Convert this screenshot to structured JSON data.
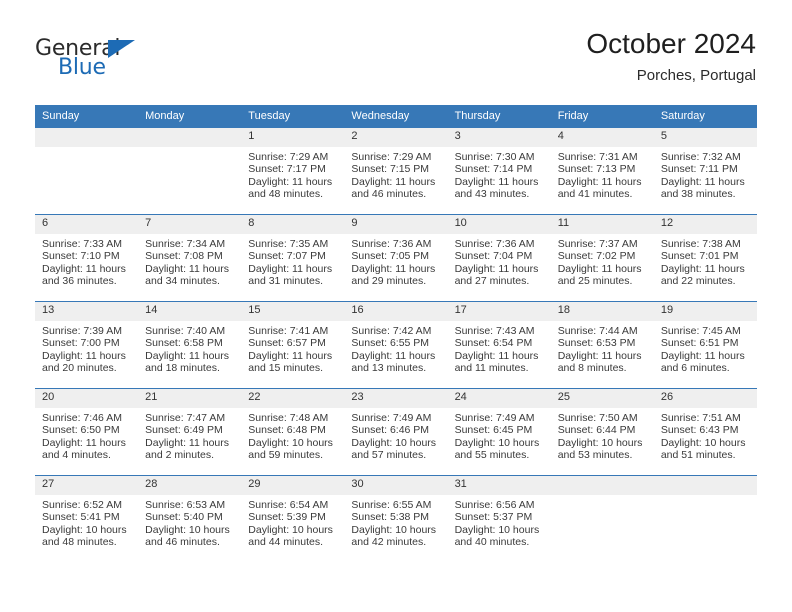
{
  "brand": {
    "name_part1": "General",
    "name_part2": "Blue",
    "triangle_icon": "triangle-icon",
    "color_dark": "#2b2b2b",
    "color_blue": "#1d6bb5"
  },
  "header": {
    "title": "October 2024",
    "subtitle": "Porches, Portugal"
  },
  "theme": {
    "header_bg": "#3778b7",
    "daynum_band_bg": "#efefef",
    "text": "#3a3a3a"
  },
  "calendar": {
    "weekday_headers": [
      "Sunday",
      "Monday",
      "Tuesday",
      "Wednesday",
      "Thursday",
      "Friday",
      "Saturday"
    ],
    "labels": {
      "sunrise": "Sunrise:",
      "sunset": "Sunset:",
      "daylight": "Daylight:"
    },
    "weeks": [
      [
        {
          "day": "",
          "blank": true
        },
        {
          "day": "",
          "blank": true
        },
        {
          "day": "1",
          "sunrise": "Sunrise: 7:29 AM",
          "sunset": "Sunset: 7:17 PM",
          "daylight": "Daylight: 11 hours and 48 minutes."
        },
        {
          "day": "2",
          "sunrise": "Sunrise: 7:29 AM",
          "sunset": "Sunset: 7:15 PM",
          "daylight": "Daylight: 11 hours and 46 minutes."
        },
        {
          "day": "3",
          "sunrise": "Sunrise: 7:30 AM",
          "sunset": "Sunset: 7:14 PM",
          "daylight": "Daylight: 11 hours and 43 minutes."
        },
        {
          "day": "4",
          "sunrise": "Sunrise: 7:31 AM",
          "sunset": "Sunset: 7:13 PM",
          "daylight": "Daylight: 11 hours and 41 minutes."
        },
        {
          "day": "5",
          "sunrise": "Sunrise: 7:32 AM",
          "sunset": "Sunset: 7:11 PM",
          "daylight": "Daylight: 11 hours and 38 minutes."
        }
      ],
      [
        {
          "day": "6",
          "sunrise": "Sunrise: 7:33 AM",
          "sunset": "Sunset: 7:10 PM",
          "daylight": "Daylight: 11 hours and 36 minutes."
        },
        {
          "day": "7",
          "sunrise": "Sunrise: 7:34 AM",
          "sunset": "Sunset: 7:08 PM",
          "daylight": "Daylight: 11 hours and 34 minutes."
        },
        {
          "day": "8",
          "sunrise": "Sunrise: 7:35 AM",
          "sunset": "Sunset: 7:07 PM",
          "daylight": "Daylight: 11 hours and 31 minutes."
        },
        {
          "day": "9",
          "sunrise": "Sunrise: 7:36 AM",
          "sunset": "Sunset: 7:05 PM",
          "daylight": "Daylight: 11 hours and 29 minutes."
        },
        {
          "day": "10",
          "sunrise": "Sunrise: 7:36 AM",
          "sunset": "Sunset: 7:04 PM",
          "daylight": "Daylight: 11 hours and 27 minutes."
        },
        {
          "day": "11",
          "sunrise": "Sunrise: 7:37 AM",
          "sunset": "Sunset: 7:02 PM",
          "daylight": "Daylight: 11 hours and 25 minutes."
        },
        {
          "day": "12",
          "sunrise": "Sunrise: 7:38 AM",
          "sunset": "Sunset: 7:01 PM",
          "daylight": "Daylight: 11 hours and 22 minutes."
        }
      ],
      [
        {
          "day": "13",
          "sunrise": "Sunrise: 7:39 AM",
          "sunset": "Sunset: 7:00 PM",
          "daylight": "Daylight: 11 hours and 20 minutes."
        },
        {
          "day": "14",
          "sunrise": "Sunrise: 7:40 AM",
          "sunset": "Sunset: 6:58 PM",
          "daylight": "Daylight: 11 hours and 18 minutes."
        },
        {
          "day": "15",
          "sunrise": "Sunrise: 7:41 AM",
          "sunset": "Sunset: 6:57 PM",
          "daylight": "Daylight: 11 hours and 15 minutes."
        },
        {
          "day": "16",
          "sunrise": "Sunrise: 7:42 AM",
          "sunset": "Sunset: 6:55 PM",
          "daylight": "Daylight: 11 hours and 13 minutes."
        },
        {
          "day": "17",
          "sunrise": "Sunrise: 7:43 AM",
          "sunset": "Sunset: 6:54 PM",
          "daylight": "Daylight: 11 hours and 11 minutes."
        },
        {
          "day": "18",
          "sunrise": "Sunrise: 7:44 AM",
          "sunset": "Sunset: 6:53 PM",
          "daylight": "Daylight: 11 hours and 8 minutes."
        },
        {
          "day": "19",
          "sunrise": "Sunrise: 7:45 AM",
          "sunset": "Sunset: 6:51 PM",
          "daylight": "Daylight: 11 hours and 6 minutes."
        }
      ],
      [
        {
          "day": "20",
          "sunrise": "Sunrise: 7:46 AM",
          "sunset": "Sunset: 6:50 PM",
          "daylight": "Daylight: 11 hours and 4 minutes."
        },
        {
          "day": "21",
          "sunrise": "Sunrise: 7:47 AM",
          "sunset": "Sunset: 6:49 PM",
          "daylight": "Daylight: 11 hours and 2 minutes."
        },
        {
          "day": "22",
          "sunrise": "Sunrise: 7:48 AM",
          "sunset": "Sunset: 6:48 PM",
          "daylight": "Daylight: 10 hours and 59 minutes."
        },
        {
          "day": "23",
          "sunrise": "Sunrise: 7:49 AM",
          "sunset": "Sunset: 6:46 PM",
          "daylight": "Daylight: 10 hours and 57 minutes."
        },
        {
          "day": "24",
          "sunrise": "Sunrise: 7:49 AM",
          "sunset": "Sunset: 6:45 PM",
          "daylight": "Daylight: 10 hours and 55 minutes."
        },
        {
          "day": "25",
          "sunrise": "Sunrise: 7:50 AM",
          "sunset": "Sunset: 6:44 PM",
          "daylight": "Daylight: 10 hours and 53 minutes."
        },
        {
          "day": "26",
          "sunrise": "Sunrise: 7:51 AM",
          "sunset": "Sunset: 6:43 PM",
          "daylight": "Daylight: 10 hours and 51 minutes."
        }
      ],
      [
        {
          "day": "27",
          "sunrise": "Sunrise: 6:52 AM",
          "sunset": "Sunset: 5:41 PM",
          "daylight": "Daylight: 10 hours and 48 minutes."
        },
        {
          "day": "28",
          "sunrise": "Sunrise: 6:53 AM",
          "sunset": "Sunset: 5:40 PM",
          "daylight": "Daylight: 10 hours and 46 minutes."
        },
        {
          "day": "29",
          "sunrise": "Sunrise: 6:54 AM",
          "sunset": "Sunset: 5:39 PM",
          "daylight": "Daylight: 10 hours and 44 minutes."
        },
        {
          "day": "30",
          "sunrise": "Sunrise: 6:55 AM",
          "sunset": "Sunset: 5:38 PM",
          "daylight": "Daylight: 10 hours and 42 minutes."
        },
        {
          "day": "31",
          "sunrise": "Sunrise: 6:56 AM",
          "sunset": "Sunset: 5:37 PM",
          "daylight": "Daylight: 10 hours and 40 minutes."
        },
        {
          "day": "",
          "blank": true
        },
        {
          "day": "",
          "blank": true
        }
      ]
    ]
  }
}
